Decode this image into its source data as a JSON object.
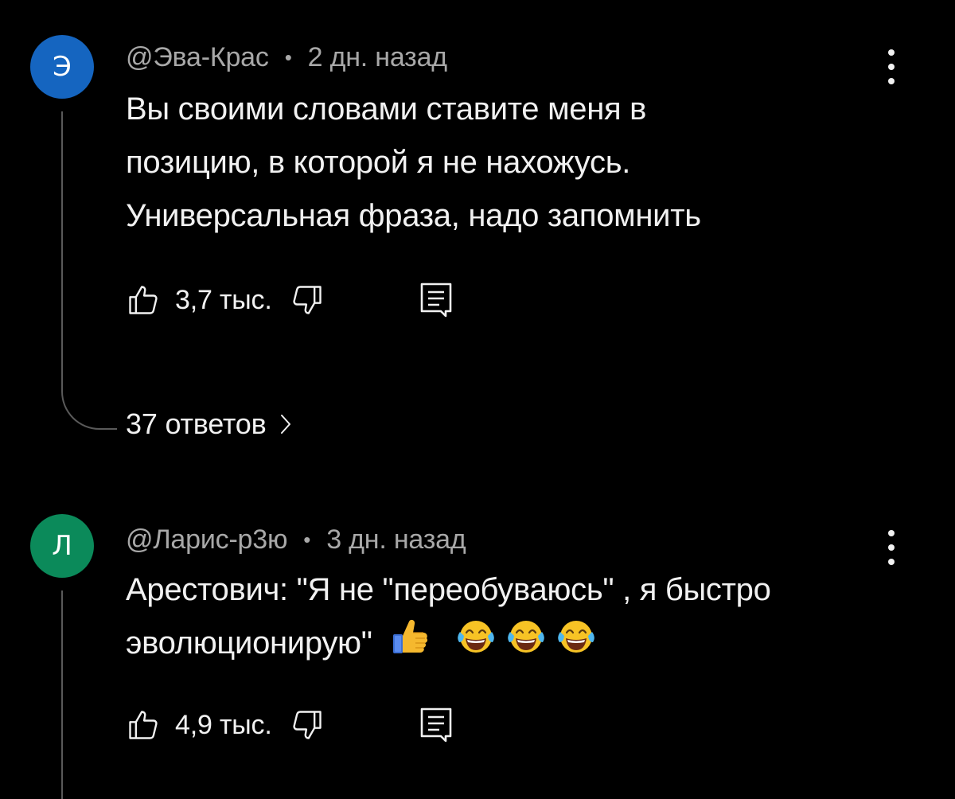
{
  "comments": [
    {
      "avatar_letter": "Э",
      "avatar_color": "#1565c0",
      "author": "@Эва-Крас",
      "separator": "•",
      "time": "2 дн. назад",
      "lines": [
        "Вы своими словами ставите меня в",
        "позицию, в которой я не нахожусь.",
        "Универсальная фраза, надо запомнить"
      ],
      "likes": "3,7 тыс.",
      "replies": "37 ответов"
    },
    {
      "avatar_letter": "Л",
      "avatar_color": "#0b8a5a",
      "author": "@Ларис-р3ю",
      "separator": "•",
      "time": "3 дн. назад",
      "lines": [
        "Арестович: \"Я не \"переобуваюсь\" , я быстро",
        "эволюционирую\""
      ],
      "emojis": [
        "thumbs-up",
        "tears-of-joy",
        "tears-of-joy",
        "tears-of-joy"
      ],
      "likes": "4,9 тыс."
    }
  ],
  "colors": {
    "background": "#000000",
    "text": "#f1f1f1",
    "meta": "#a8a8a8",
    "thread_line": "#5a5a5a"
  }
}
